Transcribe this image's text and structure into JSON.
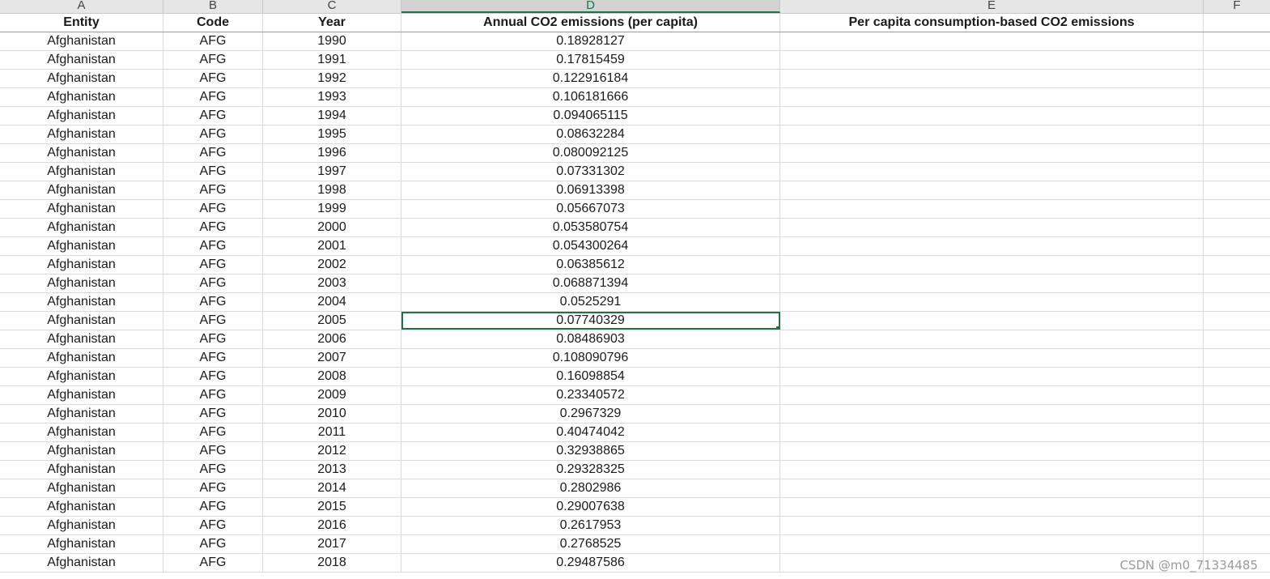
{
  "column_letters": [
    "A",
    "B",
    "C",
    "D",
    "E",
    "F"
  ],
  "active_column": "D",
  "headers": {
    "entity": "Entity",
    "code": "Code",
    "year": "Year",
    "annual": "Annual CO2 emissions (per capita)",
    "consumption": "Per capita consumption-based CO2 emissions"
  },
  "rows": [
    {
      "entity": "Afghanistan",
      "code": "AFG",
      "year": "1990",
      "annual": "0.18928127"
    },
    {
      "entity": "Afghanistan",
      "code": "AFG",
      "year": "1991",
      "annual": "0.17815459"
    },
    {
      "entity": "Afghanistan",
      "code": "AFG",
      "year": "1992",
      "annual": "0.122916184"
    },
    {
      "entity": "Afghanistan",
      "code": "AFG",
      "year": "1993",
      "annual": "0.106181666"
    },
    {
      "entity": "Afghanistan",
      "code": "AFG",
      "year": "1994",
      "annual": "0.094065115"
    },
    {
      "entity": "Afghanistan",
      "code": "AFG",
      "year": "1995",
      "annual": "0.08632284"
    },
    {
      "entity": "Afghanistan",
      "code": "AFG",
      "year": "1996",
      "annual": "0.080092125"
    },
    {
      "entity": "Afghanistan",
      "code": "AFG",
      "year": "1997",
      "annual": "0.07331302"
    },
    {
      "entity": "Afghanistan",
      "code": "AFG",
      "year": "1998",
      "annual": "0.06913398"
    },
    {
      "entity": "Afghanistan",
      "code": "AFG",
      "year": "1999",
      "annual": "0.05667073"
    },
    {
      "entity": "Afghanistan",
      "code": "AFG",
      "year": "2000",
      "annual": "0.053580754"
    },
    {
      "entity": "Afghanistan",
      "code": "AFG",
      "year": "2001",
      "annual": "0.054300264"
    },
    {
      "entity": "Afghanistan",
      "code": "AFG",
      "year": "2002",
      "annual": "0.06385612"
    },
    {
      "entity": "Afghanistan",
      "code": "AFG",
      "year": "2003",
      "annual": "0.068871394"
    },
    {
      "entity": "Afghanistan",
      "code": "AFG",
      "year": "2004",
      "annual": "0.0525291"
    },
    {
      "entity": "Afghanistan",
      "code": "AFG",
      "year": "2005",
      "annual": "0.07740329",
      "selected": true
    },
    {
      "entity": "Afghanistan",
      "code": "AFG",
      "year": "2006",
      "annual": "0.08486903"
    },
    {
      "entity": "Afghanistan",
      "code": "AFG",
      "year": "2007",
      "annual": "0.108090796"
    },
    {
      "entity": "Afghanistan",
      "code": "AFG",
      "year": "2008",
      "annual": "0.16098854"
    },
    {
      "entity": "Afghanistan",
      "code": "AFG",
      "year": "2009",
      "annual": "0.23340572"
    },
    {
      "entity": "Afghanistan",
      "code": "AFG",
      "year": "2010",
      "annual": "0.2967329"
    },
    {
      "entity": "Afghanistan",
      "code": "AFG",
      "year": "2011",
      "annual": "0.40474042"
    },
    {
      "entity": "Afghanistan",
      "code": "AFG",
      "year": "2012",
      "annual": "0.32938865"
    },
    {
      "entity": "Afghanistan",
      "code": "AFG",
      "year": "2013",
      "annual": "0.29328325"
    },
    {
      "entity": "Afghanistan",
      "code": "AFG",
      "year": "2014",
      "annual": "0.2802986"
    },
    {
      "entity": "Afghanistan",
      "code": "AFG",
      "year": "2015",
      "annual": "0.29007638"
    },
    {
      "entity": "Afghanistan",
      "code": "AFG",
      "year": "2016",
      "annual": "0.2617953"
    },
    {
      "entity": "Afghanistan",
      "code": "AFG",
      "year": "2017",
      "annual": "0.2768525"
    },
    {
      "entity": "Afghanistan",
      "code": "AFG",
      "year": "2018",
      "annual": "0.29487586"
    }
  ],
  "watermark": "CSDN @m0_71334485",
  "colors": {
    "accent": "#217346",
    "header_bg": "#e6e6e6",
    "gridline": "#dadada"
  }
}
